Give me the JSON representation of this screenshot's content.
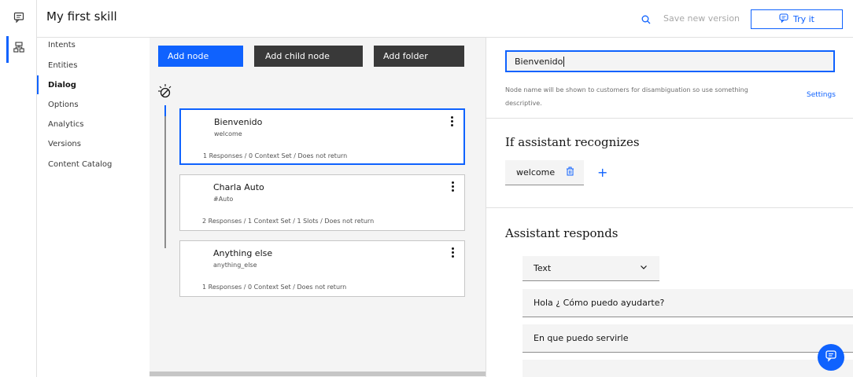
{
  "header": {
    "title": "My first skill",
    "save_label": "Save new version",
    "try_label": "Try it"
  },
  "sidenav": {
    "items": [
      {
        "label": "Intents"
      },
      {
        "label": "Entities"
      },
      {
        "label": "Dialog"
      },
      {
        "label": "Options"
      },
      {
        "label": "Analytics"
      },
      {
        "label": "Versions"
      },
      {
        "label": "Content Catalog"
      }
    ],
    "active": "Dialog"
  },
  "toolbar": {
    "add_node": "Add node",
    "add_child_node": "Add child node",
    "add_folder": "Add folder"
  },
  "nodes": [
    {
      "name": "Bienvenido",
      "condition": "welcome",
      "meta": "1 Responses / 0 Context Set / Does not return"
    },
    {
      "name": "Charla Auto",
      "condition": "#Auto",
      "meta": "2 Responses / 1 Context Set / 1 Slots / Does not return"
    },
    {
      "name": "Anything else",
      "condition": "anything_else",
      "meta": "1 Responses / 0 Context Set / Does not return"
    }
  ],
  "panel": {
    "node_name_value": "Bienvenido",
    "help_text": "Node name will be shown to customers for disambiguation so use something descriptive.",
    "settings_label": "Settings",
    "recognizes_title": "If assistant recognizes",
    "condition_chip": "welcome",
    "responds_title": "Assistant responds",
    "response_type": "Text",
    "responses": [
      "Hola ¿ Cómo puedo ayudarte?",
      "En que puedo servirle"
    ]
  },
  "colors": {
    "accent": "#0f62fe",
    "dark_button": "#393939",
    "canvas_bg": "#f4f4f4"
  }
}
